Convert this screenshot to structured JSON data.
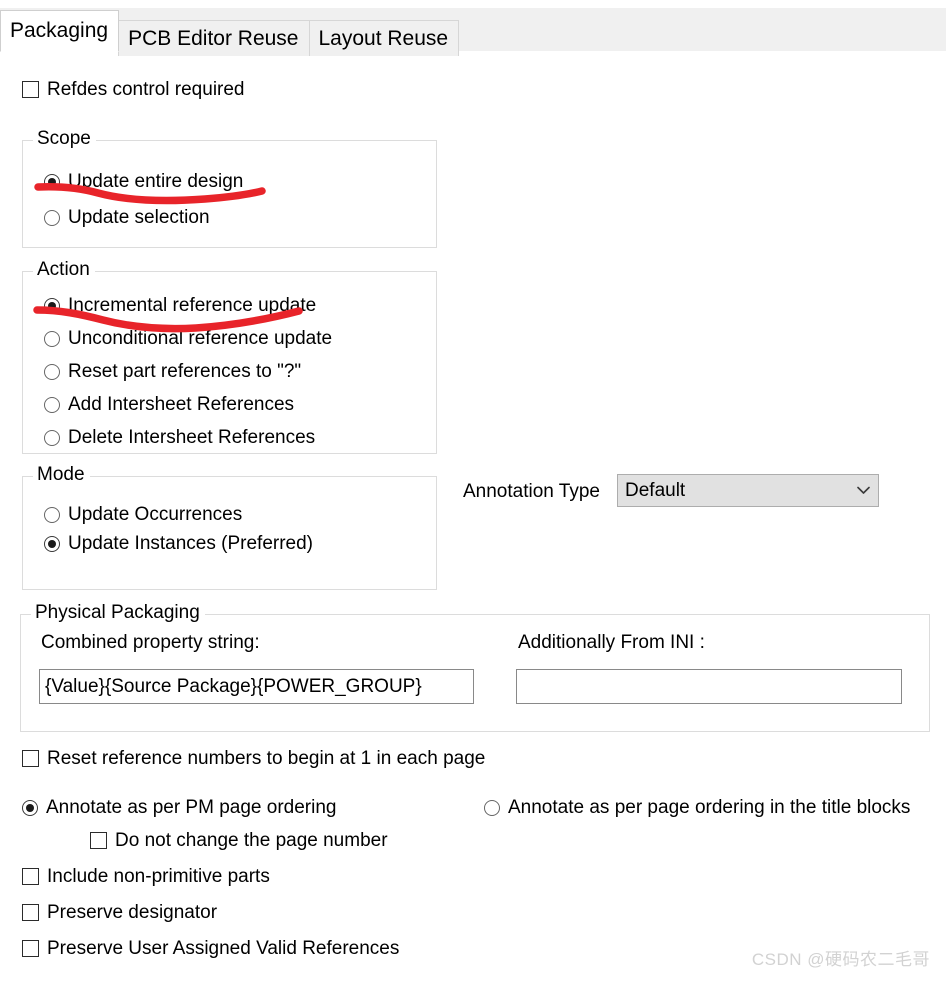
{
  "window": {
    "title": "Packaging"
  },
  "tabs": [
    {
      "label": "Packaging",
      "active": true
    },
    {
      "label": "PCB Editor Reuse",
      "active": false
    },
    {
      "label": "Layout Reuse",
      "active": false
    }
  ],
  "refdes_control": {
    "label": "Refdes control required",
    "checked": false
  },
  "scope": {
    "title": "Scope",
    "options": [
      {
        "label": "Update entire design",
        "selected": true
      },
      {
        "label": "Update selection",
        "selected": false
      }
    ]
  },
  "action": {
    "title": "Action",
    "options": [
      {
        "label": "Incremental reference update",
        "selected": true
      },
      {
        "label": "Unconditional reference update",
        "selected": false
      },
      {
        "label": "Reset part references to \"?\"",
        "selected": false
      },
      {
        "label": "Add Intersheet References",
        "selected": false
      },
      {
        "label": "Delete Intersheet References",
        "selected": false
      }
    ]
  },
  "mode": {
    "title": "Mode",
    "options": [
      {
        "label": "Update Occurrences",
        "selected": false
      },
      {
        "label": "Update Instances (Preferred)",
        "selected": true
      }
    ]
  },
  "annotation_type": {
    "label": "Annotation Type",
    "value": "Default",
    "options": [
      "Default"
    ],
    "arrow_icon": "chevron-down-icon"
  },
  "physical_packaging": {
    "title": "Physical Packaging",
    "combined_property": {
      "label": "Combined property string:",
      "value": "{Value}{Source Package}{POWER_GROUP}",
      "placeholder": ""
    },
    "additionally_from_ini": {
      "label": "Additionally From INI :",
      "value": "",
      "placeholder": ""
    }
  },
  "bottom_options": {
    "reset_reference_numbers": {
      "label": "Reset reference numbers to begin at 1 in each page",
      "checked": false
    },
    "page_ordering": [
      {
        "label": "Annotate as per PM page ordering",
        "selected": true
      },
      {
        "label": "Annotate as per page ordering in the title blocks",
        "selected": false
      }
    ],
    "do_not_change_page_number": {
      "label": "Do not change the page number",
      "checked": false
    },
    "include_non_primitive": {
      "label": "Include non-primitive parts",
      "checked": false
    },
    "preserve_designator": {
      "label": "Preserve designator",
      "checked": false
    },
    "preserve_user_assigned": {
      "label": "Preserve User Assigned Valid References",
      "checked": false
    }
  },
  "annotations": {
    "color": "#e8242a",
    "strokes": [
      {
        "name": "underline-update-entire-design"
      },
      {
        "name": "underline-incremental-reference-update"
      }
    ]
  },
  "watermark": {
    "text": "CSDN @硬码农二毛哥"
  },
  "colors": {
    "background": "#ffffff",
    "tabstrip": "#f0f0f0",
    "tab_border": "#d6d6d6",
    "group_border": "#dcdcdc",
    "combo_bg": "#e1e1e1",
    "combo_border": "#adadad",
    "input_border": "#898989",
    "annotation_red": "#e8242a",
    "watermark": "#d2d2d2"
  }
}
